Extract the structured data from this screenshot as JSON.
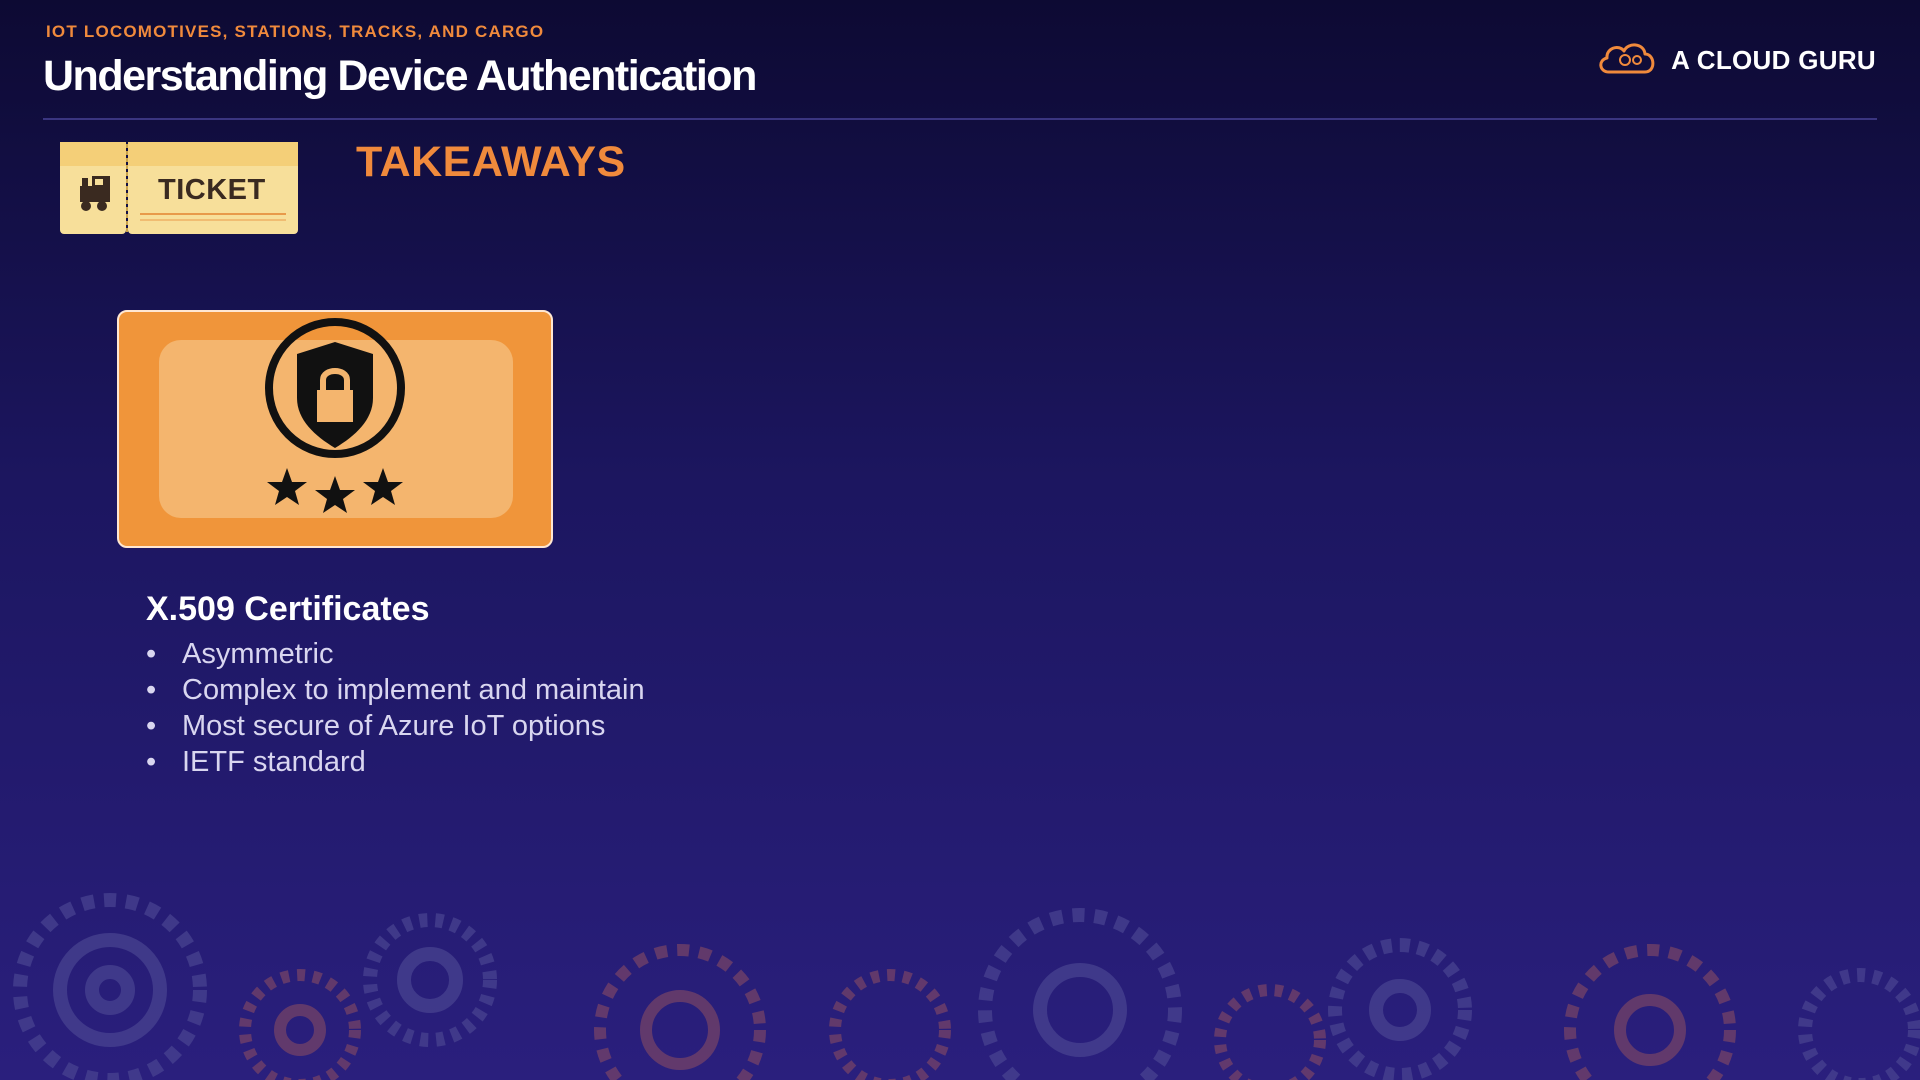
{
  "header": {
    "eyebrow": "IOT LOCOMOTIVES, STATIONS, TRACKS, AND CARGO",
    "title": "Understanding Device Authentication",
    "brand": "A CLOUD GURU"
  },
  "ticket": {
    "label": "TICKET"
  },
  "section": {
    "label": "TAKEAWAYS"
  },
  "content": {
    "heading": "X.509 Certificates",
    "bullets": [
      "Asymmetric",
      "Complex to implement and maintain",
      "Most secure of Azure IoT options",
      "IETF standard"
    ]
  },
  "icons": {
    "brand": "cloud-logo-icon",
    "ticket": "train-icon",
    "badge": "shield-lock-stars-icon"
  },
  "colors": {
    "accent": "#f08a3c",
    "background": "#1c1660",
    "text": "#ffffff",
    "card": "#f0953a"
  }
}
